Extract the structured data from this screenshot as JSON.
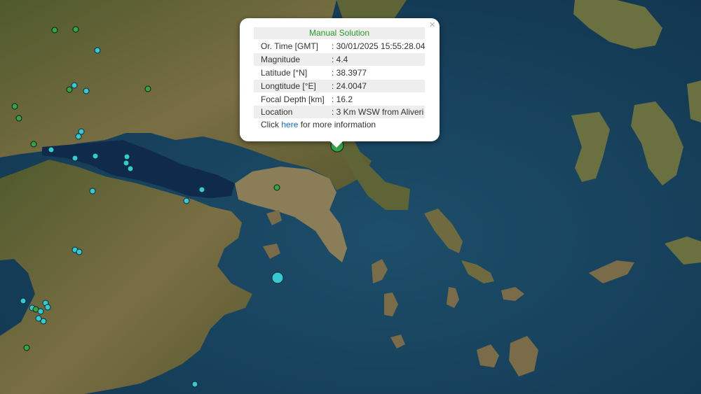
{
  "popup": {
    "close_label": "×",
    "title": "Manual Solution",
    "rows": [
      {
        "label": "Or. Time [GMT]",
        "value": ": 30/01/2025 15:55:28.04"
      },
      {
        "label": "Magnitude",
        "value": ": 4.4"
      },
      {
        "label": "Latitude [°N]",
        "value": ": 38.3977"
      },
      {
        "label": "Longtitude [°E]",
        "value": ": 24.0047"
      },
      {
        "label": "Focal Depth [km]",
        "value": ": 16.2"
      },
      {
        "label": "Location",
        "value": ": 3 Km WSW from Aliveri"
      }
    ],
    "more_prefix": "Click ",
    "more_link": "here",
    "more_suffix": " for more information"
  },
  "colors": {
    "sea": "#17405a",
    "land": "#6e6a3c",
    "quake_cyan": "#36c9d3",
    "quake_green": "#35a34a",
    "title_green": "#2a9a25",
    "link": "#1565c0"
  }
}
